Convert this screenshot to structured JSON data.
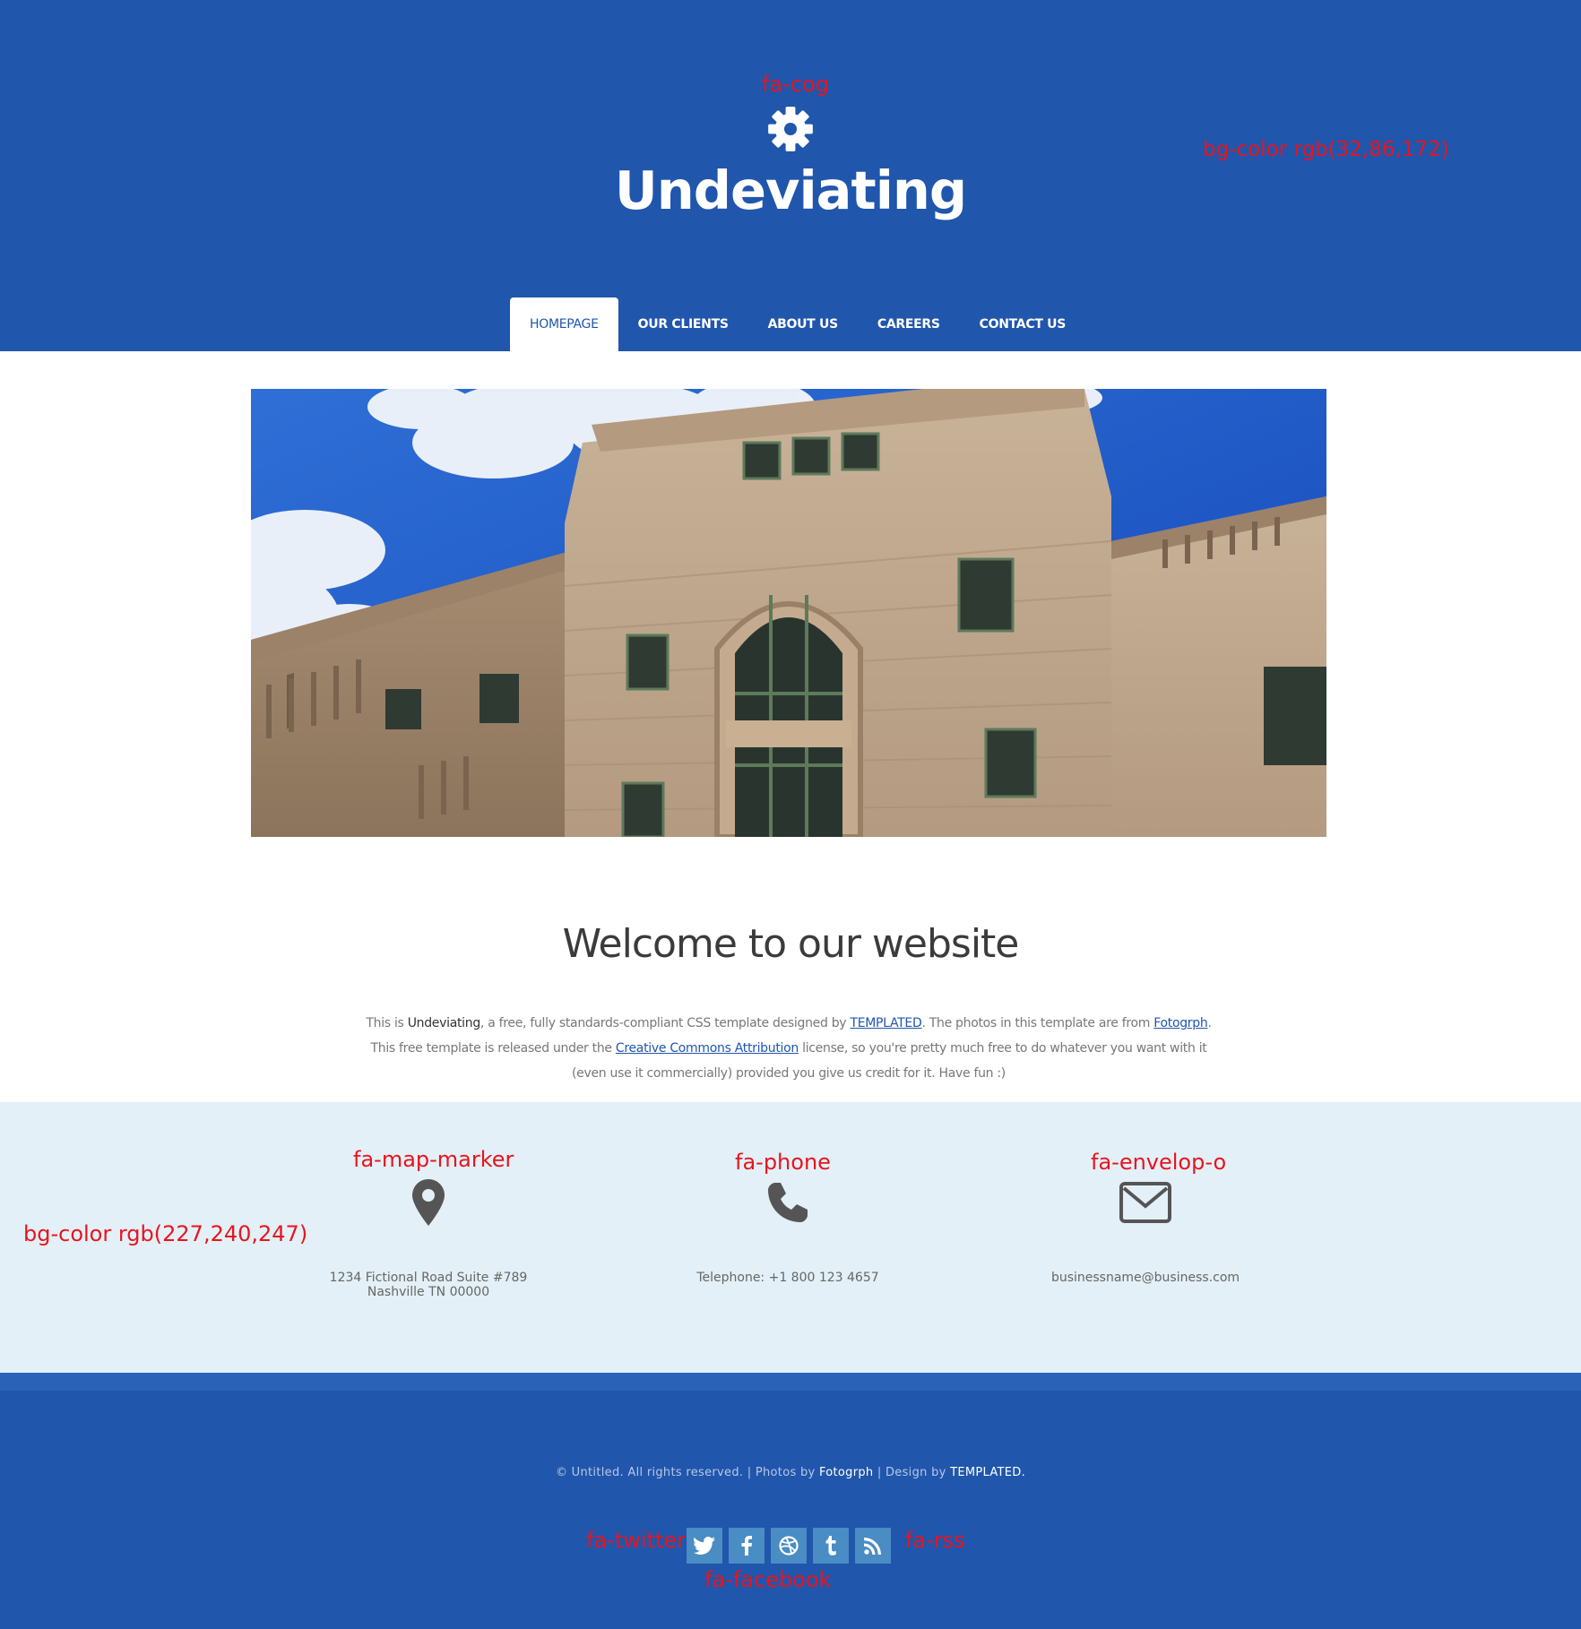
{
  "header": {
    "title": "Undeviating",
    "bg_color": "#2056ac",
    "logo_icon": "cog-icon"
  },
  "nav": {
    "items": [
      {
        "label": "HOMEPAGE",
        "active": true
      },
      {
        "label": "OUR CLIENTS",
        "active": false
      },
      {
        "label": "ABOUT US",
        "active": false
      },
      {
        "label": "CAREERS",
        "active": false
      },
      {
        "label": "CONTACT US",
        "active": false
      }
    ]
  },
  "welcome": {
    "title": "Welcome to our website",
    "p1_a": "This is ",
    "p1_site": "Undeviating",
    "p1_b": ", a free, fully standards-compliant CSS template designed by ",
    "p1_link1": "TEMPLATED",
    "p1_c": ". The photos in this template are from ",
    "p1_link2": "Fotogrph",
    "p1_d": ".",
    "p2_a": "This free template is released under the ",
    "p2_link": "Creative Commons Attribution",
    "p2_b": " license, so you're pretty much free to do whatever you want with it",
    "p3": "(even use it commercially) provided you give us credit for it. Have fun :)"
  },
  "contact": {
    "bg_color": "#e3f0f7",
    "address_line1": "1234 Fictional Road Suite #789",
    "address_line2": "Nashville TN 00000",
    "phone": "Telephone: +1 800 123 4657",
    "email": "businessname@business.com",
    "icons": [
      "map-marker-icon",
      "phone-icon",
      "envelope-icon"
    ]
  },
  "footer": {
    "copyright_a": "© Untitled. All rights reserved. | Photos by ",
    "copyright_b": "Fotogrph",
    "copyright_c": " | Design by ",
    "copyright_d": "TEMPLATED.",
    "social_icons": [
      "twitter-icon",
      "facebook-icon",
      "dribbble-icon",
      "tumblr-icon",
      "rss-icon"
    ]
  },
  "annotations": {
    "cog": "fa-cog",
    "header_bg": "bg-color rgb(32,86,172)",
    "map_marker": "fa-map-marker",
    "phone": "fa-phone",
    "envelope": "fa-envelop-o",
    "contact_bg": "bg-color rgb(227,240,247)",
    "twitter": "fa-twitter",
    "rss": "fa-rss",
    "facebook": "fa-facebook"
  }
}
